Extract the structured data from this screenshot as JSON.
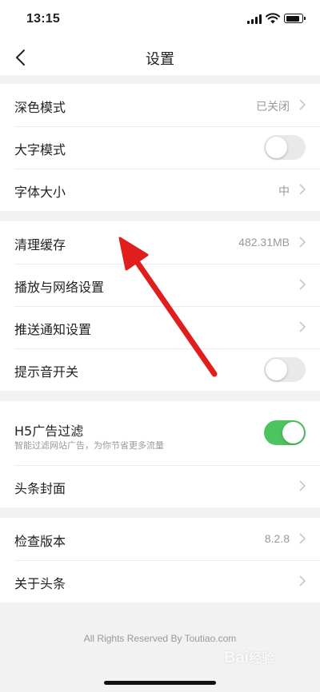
{
  "status": {
    "time": "13:15"
  },
  "nav": {
    "title": "设置"
  },
  "groups": [
    {
      "rows": [
        {
          "label": "深色模式",
          "value": "已关闭"
        },
        {
          "label": "大字模式",
          "toggle": false
        },
        {
          "label": "字体大小",
          "value": "中"
        }
      ]
    },
    {
      "rows": [
        {
          "label": "清理缓存",
          "value": "482.31MB"
        },
        {
          "label": "播放与网络设置"
        },
        {
          "label": "推送通知设置"
        },
        {
          "label": "提示音开关",
          "toggle": false
        }
      ]
    },
    {
      "rows": [
        {
          "label": "H5广告过滤",
          "sub": "智能过滤网站广告，为你节省更多流量",
          "toggle": true
        },
        {
          "label": "头条封面"
        }
      ]
    },
    {
      "rows": [
        {
          "label": "检查版本",
          "value": "8.2.8"
        },
        {
          "label": "关于头条"
        }
      ]
    }
  ],
  "footer": "All Rights Reserved By Toutiao.com",
  "watermark": "Bai经验",
  "colors": {
    "toggle_on": "#4cc45f",
    "arrow": "#e01e1e",
    "background": "#f2f2f2"
  }
}
